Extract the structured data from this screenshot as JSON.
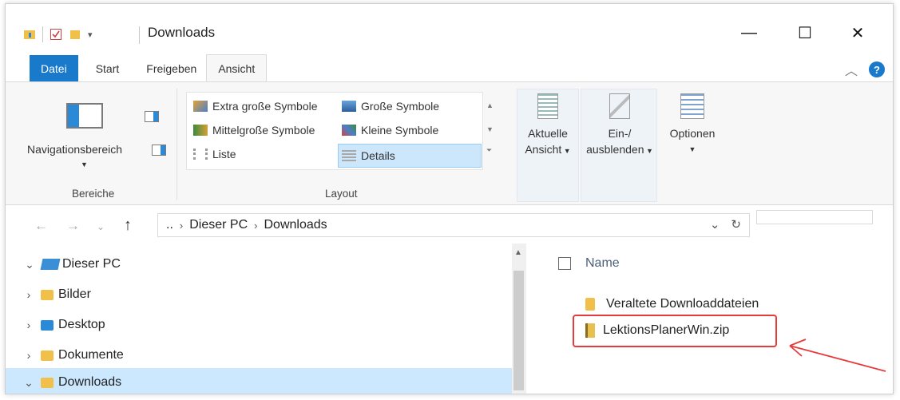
{
  "window": {
    "title": "Downloads"
  },
  "title_buttons": {
    "minimize": "—",
    "maximize": "☐",
    "close": "✕"
  },
  "tabs": [
    {
      "label": "Datei"
    },
    {
      "label": "Start"
    },
    {
      "label": "Freigeben"
    },
    {
      "label": "Ansicht"
    }
  ],
  "ribbon": {
    "bereiche": {
      "nav_label": "Navigationsbereich",
      "group_label": "Bereiche"
    },
    "layout": {
      "items": [
        "Extra große Symbole",
        "Große Symbole",
        "Mittelgroße Symbole",
        "Kleine Symbole",
        "Liste",
        "Details"
      ],
      "group_label": "Layout"
    },
    "aktuelle_ansicht": {
      "line1": "Aktuelle",
      "line2": "Ansicht"
    },
    "ein_ausblenden": {
      "line1": "Ein-/",
      "line2": "ausblenden"
    },
    "optionen": {
      "label": "Optionen"
    }
  },
  "address": {
    "ellipsis": "..",
    "crumbs": [
      "Dieser PC",
      "Downloads"
    ]
  },
  "tree": [
    {
      "label": "Dieser PC",
      "expander": "⌄"
    },
    {
      "label": "Bilder",
      "expander": "›"
    },
    {
      "label": "Desktop",
      "expander": "›"
    },
    {
      "label": "Dokumente",
      "expander": "›"
    },
    {
      "label": "Downloads",
      "expander": "⌄"
    }
  ],
  "file_list": {
    "column_name": "Name",
    "items": [
      {
        "name": "Veraltete Downloaddateien",
        "type": "folder"
      },
      {
        "name": "LektionsPlanerWin.zip",
        "type": "zip"
      }
    ]
  },
  "colors": {
    "accent": "#1979ca",
    "selection": "#cce8ff",
    "annotation": "#e53b3b"
  }
}
